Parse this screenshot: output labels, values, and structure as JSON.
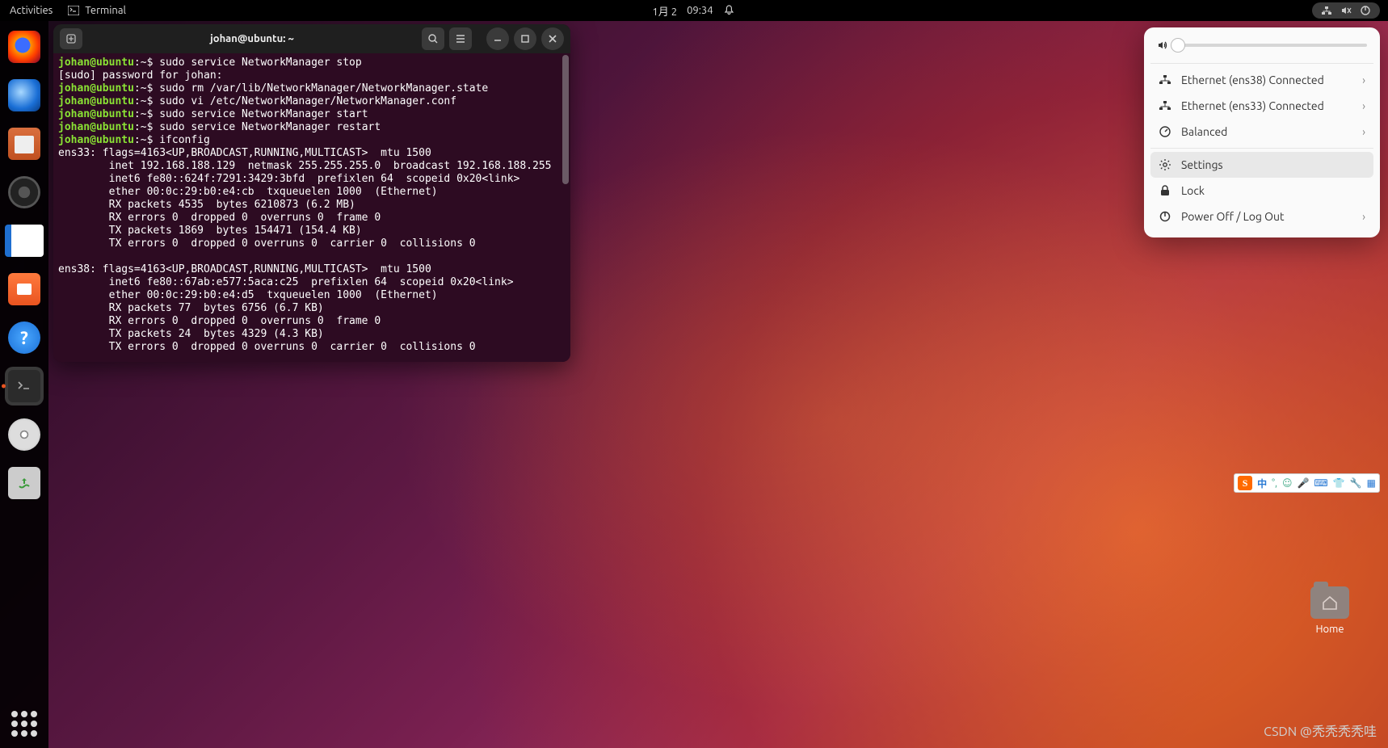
{
  "topbar": {
    "activities": "Activities",
    "app_label": "Terminal",
    "date": "1月 2",
    "time": "09:34"
  },
  "dock": {
    "items": [
      {
        "name": "firefox"
      },
      {
        "name": "thunderbird"
      },
      {
        "name": "files"
      },
      {
        "name": "rhythmbox"
      },
      {
        "name": "libreoffice-writer"
      },
      {
        "name": "ubuntu-software"
      },
      {
        "name": "help"
      },
      {
        "name": "terminal",
        "active": true
      },
      {
        "name": "disc"
      },
      {
        "name": "trash"
      }
    ]
  },
  "terminal": {
    "title": "johan@ubuntu: ~",
    "prompt_user": "johan@ubuntu",
    "prompt_path": ":~$ ",
    "lines": [
      {
        "cmd": "sudo service NetworkManager stop"
      },
      {
        "plain": "[sudo] password for johan:"
      },
      {
        "cmd": "sudo rm /var/lib/NetworkManager/NetworkManager.state"
      },
      {
        "cmd": "sudo vi /etc/NetworkManager/NetworkManager.conf"
      },
      {
        "cmd": "sudo service NetworkManager start"
      },
      {
        "cmd": "sudo service NetworkManager restart"
      },
      {
        "cmd": "ifconfig"
      }
    ],
    "output": "ens33: flags=4163<UP,BROADCAST,RUNNING,MULTICAST>  mtu 1500\n        inet 192.168.188.129  netmask 255.255.255.0  broadcast 192.168.188.255\n        inet6 fe80::624f:7291:3429:3bfd  prefixlen 64  scopeid 0x20<link>\n        ether 00:0c:29:b0:e4:cb  txqueuelen 1000  (Ethernet)\n        RX packets 4535  bytes 6210873 (6.2 MB)\n        RX errors 0  dropped 0  overruns 0  frame 0\n        TX packets 1869  bytes 154471 (154.4 KB)\n        TX errors 0  dropped 0 overruns 0  carrier 0  collisions 0\n\nens38: flags=4163<UP,BROADCAST,RUNNING,MULTICAST>  mtu 1500\n        inet6 fe80::67ab:e577:5aca:c25  prefixlen 64  scopeid 0x20<link>\n        ether 00:0c:29:b0:e4:d5  txqueuelen 1000  (Ethernet)\n        RX packets 77  bytes 6756 (6.7 KB)\n        RX errors 0  dropped 0  overruns 0  frame 0\n        TX packets 24  bytes 4329 (4.3 KB)\n        TX errors 0  dropped 0 overruns 0  carrier 0  collisions 0"
  },
  "sysmenu": {
    "items": [
      {
        "icon": "network",
        "label": "Ethernet (ens38) Connected",
        "chev": true
      },
      {
        "icon": "network",
        "label": "Ethernet (ens33) Connected",
        "chev": true
      },
      {
        "icon": "power-mode",
        "label": "Balanced",
        "chev": true
      }
    ],
    "items2": [
      {
        "icon": "settings",
        "label": "Settings",
        "hover": true
      },
      {
        "icon": "lock",
        "label": "Lock"
      },
      {
        "icon": "power",
        "label": "Power Off / Log Out",
        "chev": true
      }
    ]
  },
  "ime": {
    "lang": "中"
  },
  "desktop": {
    "folder_label": "Home"
  },
  "watermark": "CSDN @秃秃秃秃哇"
}
